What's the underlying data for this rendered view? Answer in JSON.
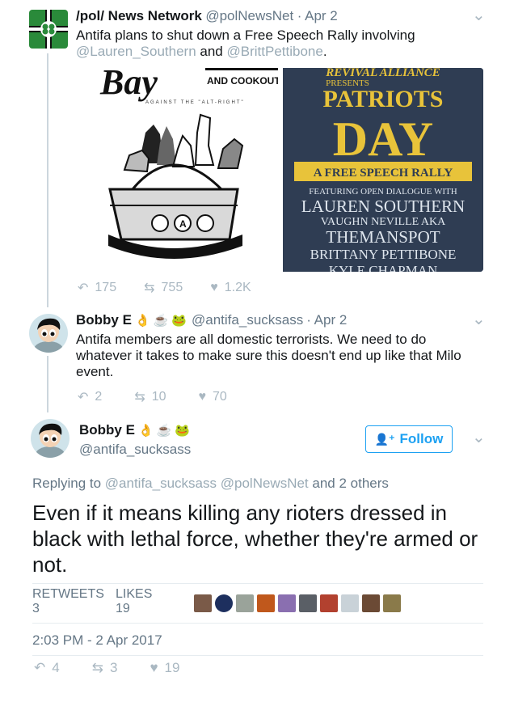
{
  "tweet1": {
    "name": "/pol/ News Network",
    "handle": "@polNewsNet",
    "time": "· Apr 2",
    "text_before": "Antifa plans to shut down a Free Speech Rally involving",
    "mention1": "@Lauren_Southern",
    "and": "and",
    "mention2": "@BrittPettibone",
    "period": ".",
    "actions": {
      "replies": "175",
      "retweets": "755",
      "likes": "1.2K"
    },
    "image_left": {
      "top_text1": "Bay",
      "top_text2": "AND COOKOUT",
      "top_text3": "AGAINST THE \"ALT-RIGHT\""
    },
    "image_right": {
      "presents_top": "REVIVAL ALLIANCE",
      "presents": "PRESENTS",
      "title1": "PATRIOTS",
      "title2": "DAY",
      "banner": "A FREE SPEECH RALLY",
      "featuring": "FEATURING OPEN DIALOGUE WITH",
      "line1": "LAUREN SOUTHERN",
      "line2": "VAUGHN NEVILLE AKA",
      "line3": "THEMANSPOT",
      "line4": "BRITTANY PETTIBONE",
      "line5": "KYLE CHAPMAN"
    }
  },
  "tweet2": {
    "name": "Bobby E",
    "handle": "@antifa_sucksass",
    "time": "· Apr 2",
    "text": "Antifa members are all domestic terrorists. We need to do whatever it takes to make sure this doesn't end up like that Milo event.",
    "actions": {
      "replies": "2",
      "retweets": "10",
      "likes": "70"
    }
  },
  "tweet3": {
    "name": "Bobby E",
    "handle": "@antifa_sucksass",
    "follow_label": "Follow",
    "replying_prefix": "Replying to",
    "reply_mention1": "@antifa_sucksass",
    "reply_mention2": "@polNewsNet",
    "reply_suffix": "and 2 others",
    "text": "Even if it means killing any rioters dressed in black with lethal force, whether they're armed or not.",
    "retweets_label": "RETWEETS",
    "retweets_value": "3",
    "likes_label": "LIKES",
    "likes_value": "19",
    "timestamp": "2:03 PM - 2 Apr 2017",
    "actions": {
      "replies": "4",
      "retweets": "3",
      "likes": "19"
    }
  },
  "colors": {
    "accent": "#1da1f2",
    "muted": "#99aab5",
    "poster_bg": "#2f3d53",
    "poster_yellow": "#e8c33a"
  },
  "icons": [
    "reply-icon",
    "retweet-icon",
    "heart-icon",
    "chevron-down-icon",
    "follow-person-icon",
    "ok-hand-emoji",
    "cup-emoji",
    "frog-emoji"
  ]
}
